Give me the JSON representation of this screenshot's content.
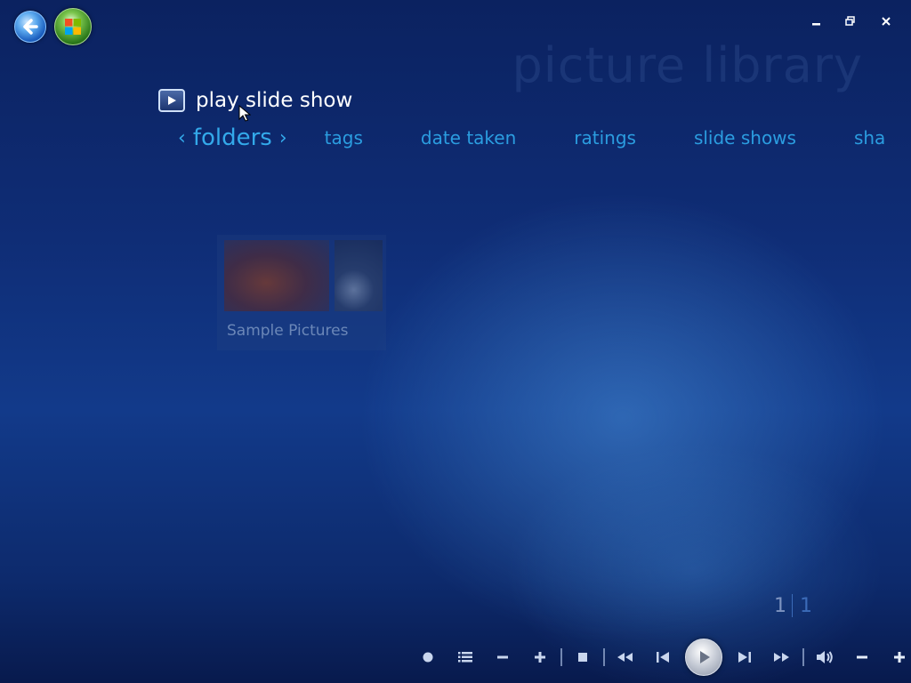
{
  "window": {
    "minimize": "minimize",
    "restore": "restore",
    "close": "close"
  },
  "header": {
    "title_watermark": "picture library"
  },
  "actions": {
    "play_slide_show": "play slide show"
  },
  "nav": {
    "active": "folders",
    "items": [
      "tags",
      "date taken",
      "ratings",
      "slide shows",
      "sha"
    ]
  },
  "gallery": {
    "folders": [
      {
        "label": "Sample Pictures"
      }
    ]
  },
  "pager": {
    "current": "1",
    "total": "1"
  },
  "transport": {
    "controls": [
      "record",
      "guide",
      "channel-down",
      "channel-up",
      "stop",
      "rewind",
      "skip-back",
      "play",
      "skip-forward",
      "fast-forward",
      "mute",
      "volume-down",
      "volume-up"
    ]
  },
  "colors": {
    "accent": "#2b9de0",
    "background": "#0f2d76",
    "text": "#ffffff"
  }
}
